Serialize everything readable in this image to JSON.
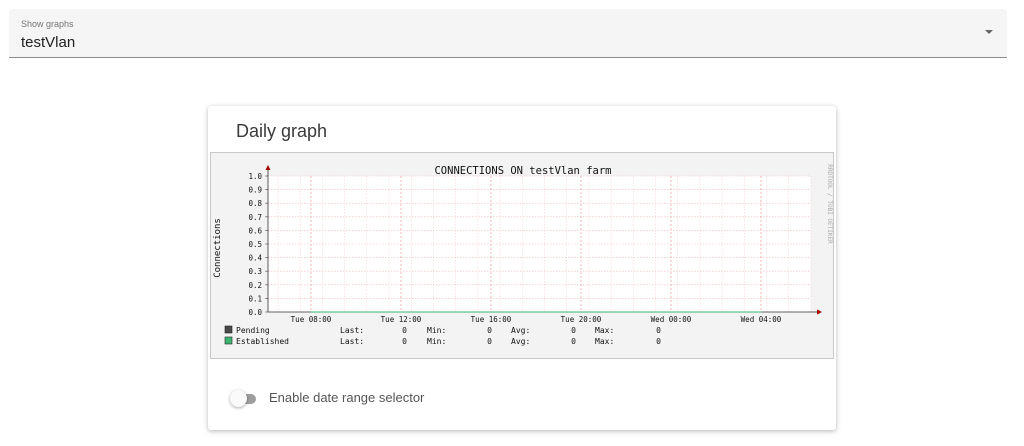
{
  "select": {
    "label": "Show graphs",
    "value": "testVlan"
  },
  "card": {
    "title": "Daily graph"
  },
  "toggle": {
    "label": "Enable date range selector",
    "checked": false
  },
  "chart_data": {
    "type": "line",
    "title": "CONNECTIONS ON testVlan farm",
    "ylabel": "Connections",
    "watermark": "RRDTOOL / TOBI OETIKER",
    "ylim": [
      0,
      1.0
    ],
    "y_ticks": [
      "0.0",
      "0.1",
      "0.2",
      "0.3",
      "0.4",
      "0.5",
      "0.6",
      "0.7",
      "0.8",
      "0.9",
      "1.0"
    ],
    "x_ticks": [
      "Tue 08:00",
      "Tue 12:00",
      "Tue 16:00",
      "Tue 20:00",
      "Wed 00:00",
      "Wed 04:00"
    ],
    "grid": true,
    "series": [
      {
        "name": "Pending",
        "color": "#4a4a4a",
        "values": [
          0,
          0,
          0,
          0,
          0,
          0
        ],
        "stats": {
          "Last:": "0",
          "Min:": "0",
          "Avg:": "0",
          "Max:": "0"
        }
      },
      {
        "name": "Established",
        "color": "#3cb371",
        "values": [
          0,
          0,
          0,
          0,
          0,
          0
        ],
        "stats": {
          "Last:": "0",
          "Min:": "0",
          "Avg:": "0",
          "Max:": "0"
        }
      }
    ]
  }
}
